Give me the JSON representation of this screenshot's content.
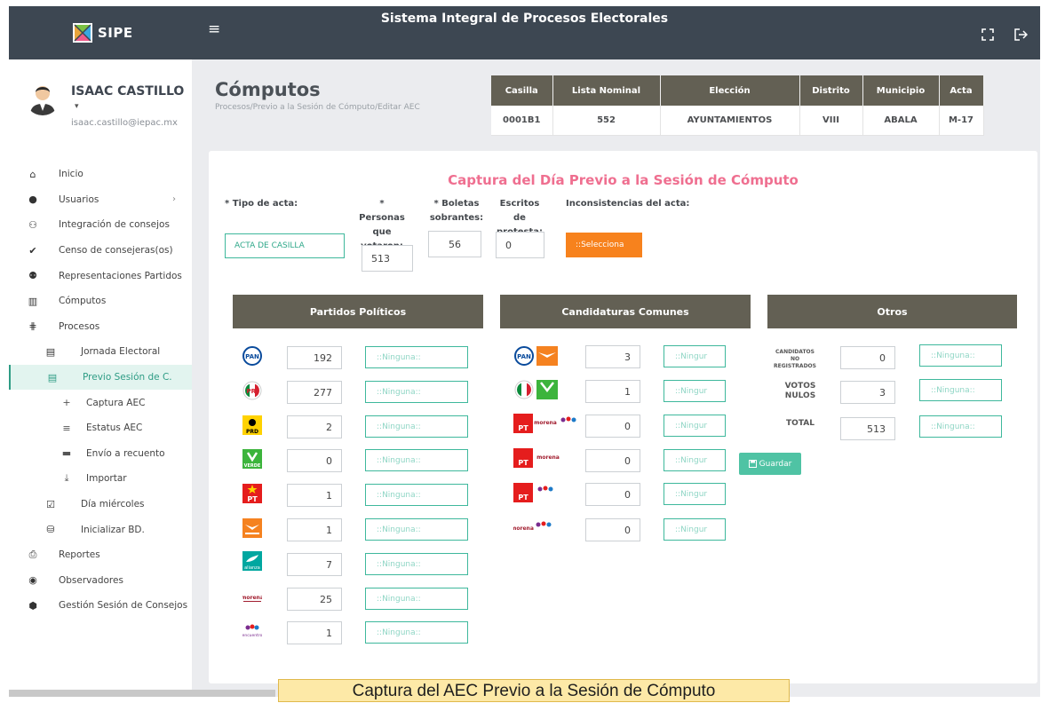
{
  "app": {
    "name": "SIPE",
    "system_title": "Sistema Integral de Procesos Electorales",
    "menu_icon": "hamburger-icon",
    "fullscreen_icon": "expand-icon",
    "logout_icon": "logout-icon"
  },
  "user": {
    "name": "ISAAC CASTILLO",
    "email": "isaac.castillo@iepac.mx",
    "caret": "▾"
  },
  "sidebar": {
    "items": [
      {
        "label": "Inicio",
        "icon": "⌂"
      },
      {
        "label": "Usuarios",
        "icon": "●",
        "chevron": "›"
      },
      {
        "label": "Integración de consejos",
        "icon": "⚇"
      },
      {
        "label": "Censo de consejeras(os)",
        "icon": "✔"
      },
      {
        "label": "Representaciones Partidos",
        "icon": "⚉"
      },
      {
        "label": "Cómputos",
        "icon": "▥"
      },
      {
        "label": "Procesos",
        "icon": "⋕"
      },
      {
        "label": "Jornada Electoral",
        "icon": "▤"
      },
      {
        "label": "Previo Sesión de C.",
        "icon": "▤"
      },
      {
        "label": "Captura AEC",
        "icon": "+"
      },
      {
        "label": "Estatus AEC",
        "icon": "≡"
      },
      {
        "label": "Envío a recuento",
        "icon": "▬"
      },
      {
        "label": "Importar",
        "icon": "⤓"
      },
      {
        "label": "Día miércoles",
        "icon": "☑"
      },
      {
        "label": "Inicializar BD.",
        "icon": "⛁"
      },
      {
        "label": "Reportes",
        "icon": "⎙"
      },
      {
        "label": "Observadores",
        "icon": "◉"
      },
      {
        "label": "Gestión Sesión de Consejos",
        "icon": "⬢"
      }
    ]
  },
  "page": {
    "title": "Cómputos",
    "breadcrumb": "Procesos/Previo a la Sesión de Cómputo/Editar AEC"
  },
  "info": {
    "headers": [
      "Casilla",
      "Lista Nominal",
      "Elección",
      "Distrito",
      "Municipio",
      "Acta"
    ],
    "values": [
      "0001B1",
      "552",
      "AYUNTAMIENTOS",
      "VIII",
      "ABALA",
      "M-17"
    ]
  },
  "form": {
    "title": "Captura del Día Previo a la Sesión de Cómputo",
    "tipo_label": "* Tipo de acta:",
    "tipo_value": "ACTA DE CASILLA",
    "personas_label": "* Personas que votaron:",
    "personas_value": "513",
    "boletas_label": "* Boletas sobrantes:",
    "boletas_value": "56",
    "escritos_label": "Escritos de protesta:",
    "escritos_value": "0",
    "inconsistencias_label": "Inconsistencias del acta:",
    "selecciona_label": "::Selecciona"
  },
  "partidos": {
    "header": "Partidos Políticos",
    "rows": [
      {
        "party": "PAN",
        "votes": "192",
        "note": "::Ninguna::"
      },
      {
        "party": "PRI",
        "votes": "277",
        "note": "::Ninguna::"
      },
      {
        "party": "PRD",
        "votes": "2",
        "note": "::Ninguna::"
      },
      {
        "party": "VERDE",
        "votes": "0",
        "note": "::Ninguna::"
      },
      {
        "party": "PT",
        "votes": "1",
        "note": "::Ninguna::"
      },
      {
        "party": "MC",
        "votes": "1",
        "note": "::Ninguna::"
      },
      {
        "party": "alianza",
        "votes": "7",
        "note": "::Ninguna::"
      },
      {
        "party": "morena",
        "votes": "25",
        "note": "::Ninguna::"
      },
      {
        "party": "encuentro",
        "votes": "1",
        "note": "::Ninguna::"
      }
    ]
  },
  "comunes": {
    "header": "Candidaturas Comunes",
    "rows": [
      {
        "parties": "PAN-MC",
        "votes": "3",
        "note": "::Ningur"
      },
      {
        "parties": "PRI-VERDE",
        "votes": "1",
        "note": "::Ningur"
      },
      {
        "parties": "PT-morena-encuentro",
        "votes": "0",
        "note": "::Ningur"
      },
      {
        "parties": "PT-morena",
        "votes": "0",
        "note": "::Ningur"
      },
      {
        "parties": "PT-encuentro",
        "votes": "0",
        "note": "::Ningur"
      },
      {
        "parties": "morena-encuentro",
        "votes": "0",
        "note": "::Ningur"
      }
    ]
  },
  "otros": {
    "header": "Otros",
    "rows": [
      {
        "label": "CANDIDATOS NO REGISTRADOS",
        "votes": "0",
        "note": "::Ninguna::"
      },
      {
        "label": "VOTOS NULOS",
        "votes": "3",
        "note": "::Ninguna::"
      },
      {
        "label": "TOTAL",
        "votes": "513",
        "note": "::Ninguna::"
      }
    ],
    "save_label": "Guardar",
    "save_icon": "save-icon"
  },
  "logo_text": {
    "pan": "PAN",
    "pri": "PRI",
    "prd": "PRD",
    "verde": "VERDE",
    "pt": "PT",
    "morena": "morena",
    "encuentro": "encuentro",
    "alianza": "alianza"
  },
  "caption": "Captura del AEC Previo a la Sesión de Cómputo",
  "colors": {
    "topbar": "#3d4752",
    "table_head": "#636054",
    "accent": "#3eb89c",
    "title_pink": "#ef6f90",
    "orange": "#f7821d"
  }
}
